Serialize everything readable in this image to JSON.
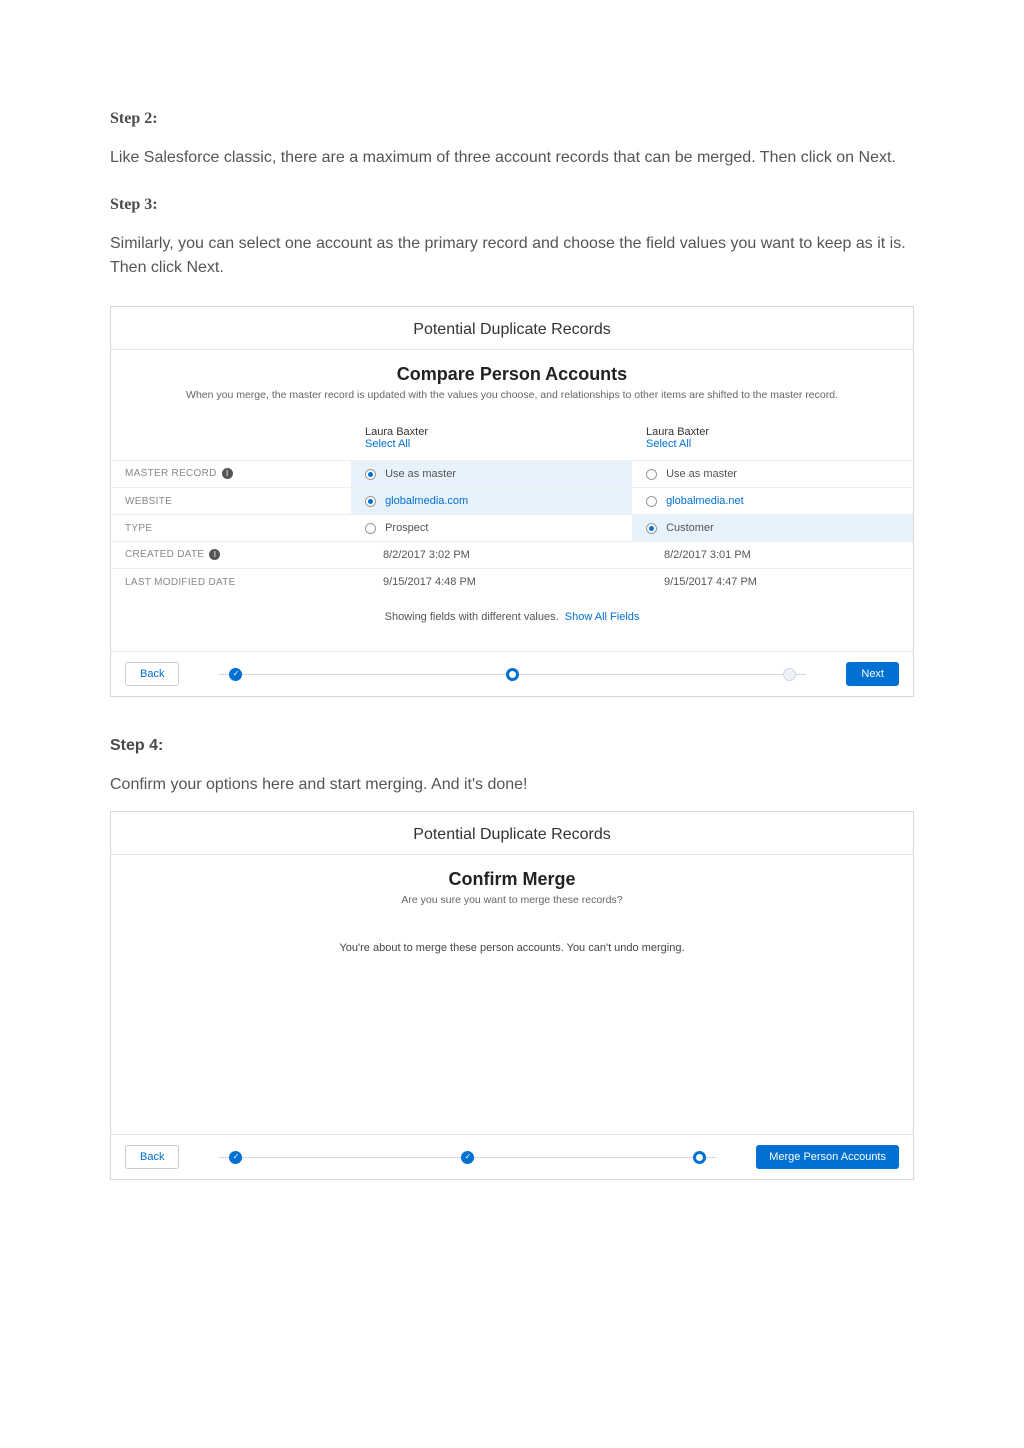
{
  "doc": {
    "step2_heading": "Step 2:",
    "step2_body": "Like Salesforce classic, there are a maximum of three account records that can be merged. Then click on Next.",
    "step3_heading": "Step 3:",
    "step3_body": "Similarly, you can select one account as the primary record and choose the field values you want to keep as it is. Then click Next.",
    "step4_heading": "Step 4:",
    "step4_body": "Confirm your options here and start merging. And it's done!"
  },
  "panel1": {
    "title": "Potential Duplicate Records",
    "section_title": "Compare Person Accounts",
    "section_subtitle": "When you merge, the master record is updated with the values you choose, and relationships to other items are shifted to the master record.",
    "col_a_name": "Laura Baxter",
    "col_b_name": "Laura Baxter",
    "select_all": "Select All",
    "rows": {
      "master_record": "MASTER RECORD",
      "website": "WEBSITE",
      "type": "TYPE",
      "created_date": "CREATED DATE",
      "last_modified": "LAST MODIFIED DATE"
    },
    "values": {
      "a_master": "Use as master",
      "b_master": "Use as master",
      "a_website": "globalmedia.com",
      "b_website": "globalmedia.net",
      "a_type": "Prospect",
      "b_type": "Customer",
      "a_created": "8/2/2017 3:02 PM",
      "b_created": "8/2/2017 3:01 PM",
      "a_modified": "9/15/2017 4:48 PM",
      "b_modified": "9/15/2017 4:47 PM"
    },
    "showing_text": "Showing fields with different values.",
    "show_all_link": "Show All Fields",
    "back_label": "Back",
    "next_label": "Next"
  },
  "panel2": {
    "title": "Potential Duplicate Records",
    "section_title": "Confirm Merge",
    "section_subtitle": "Are you sure you want to merge these records?",
    "confirm_msg": "You're about to merge these person accounts. You can't undo merging.",
    "back_label": "Back",
    "merge_label": "Merge Person Accounts"
  }
}
